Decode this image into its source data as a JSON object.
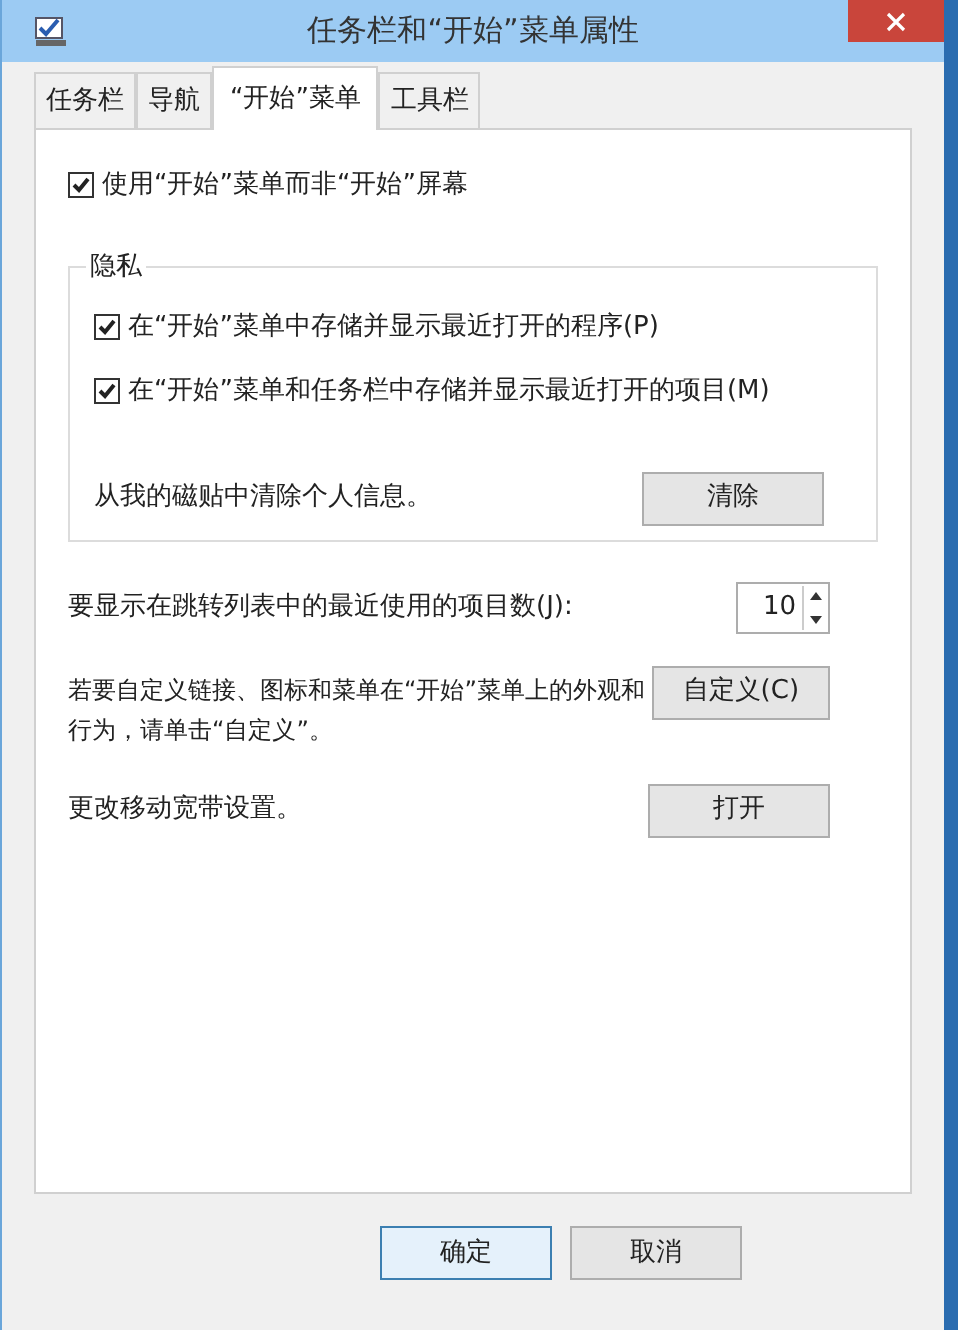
{
  "window": {
    "title": "任务栏和“开始”菜单属性"
  },
  "tabs": [
    {
      "label": "任务栏",
      "selected": false
    },
    {
      "label": "导航",
      "selected": false
    },
    {
      "label": "“开始”菜单",
      "selected": true
    },
    {
      "label": "工具栏",
      "selected": false
    }
  ],
  "use_start_menu": {
    "label": "使用“开始”菜单而非“开始”屏幕",
    "checked": true
  },
  "privacy": {
    "title": "隐私",
    "options": [
      {
        "label": "在“开始”菜单中存储并显示最近打开的程序(P)",
        "checked": true
      },
      {
        "label": "在“开始”菜单和任务栏中存储并显示最近打开的项目(M)",
        "checked": true
      }
    ],
    "clear_text": "从我的磁贴中清除个人信息。",
    "clear_button": "清除"
  },
  "recent_items": {
    "label": "要显示在跳转列表中的最近使用的项目数(J):",
    "value": "10"
  },
  "customize": {
    "text": "若要自定义链接、图标和菜单在“开始”菜单上的外观和行为，请单击“自定义”。",
    "button": "自定义(C)"
  },
  "broadband": {
    "text": "更改移动宽带设置。",
    "button": "打开"
  },
  "buttons": [
    "确定",
    "取消"
  ]
}
